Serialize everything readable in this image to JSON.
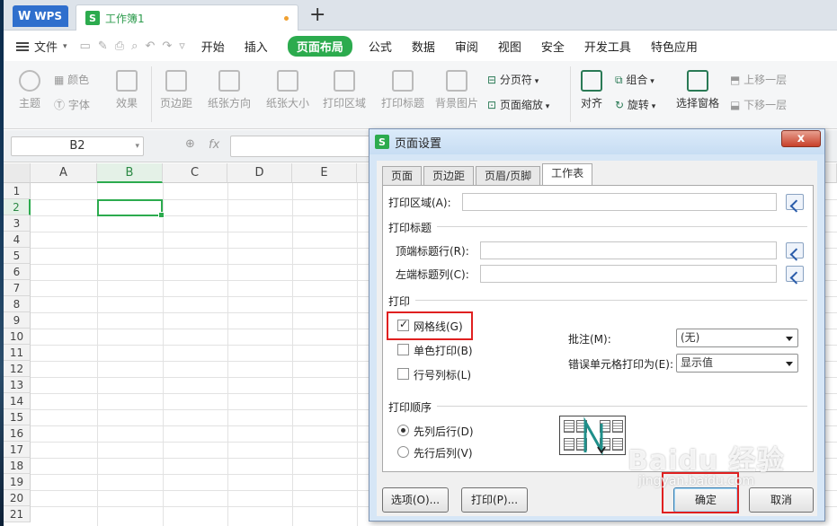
{
  "titlebar": {
    "app_tab": "WPS",
    "doc_tab": "工作簿1",
    "add_tab": "+"
  },
  "menubar": {
    "file": "文件",
    "items": [
      "开始",
      "插入",
      "页面布局",
      "公式",
      "数据",
      "审阅",
      "视图",
      "安全",
      "开发工具",
      "特色应用"
    ],
    "active_index": 2
  },
  "ribbon": {
    "theme": "主题",
    "color": "颜色",
    "font": "字体",
    "effect": "效果",
    "margin": "页边距",
    "orientation": "纸张方向",
    "size": "纸张大小",
    "print_area": "打印区域",
    "print_title": "打印标题",
    "background": "背景图片",
    "page_break": "分页符",
    "page_zoom": "页面缩放",
    "align": "对齐",
    "group": "组合",
    "rotate": "旋转",
    "select_pane": "选择窗格",
    "bring_forward": "上移一层",
    "send_backward": "下移一层"
  },
  "formula_bar": {
    "name_box": "B2",
    "fx": "fx"
  },
  "grid": {
    "columns": [
      "A",
      "B",
      "C",
      "D",
      "E"
    ],
    "rows": [
      "1",
      "2",
      "3",
      "4",
      "5",
      "6",
      "7",
      "8",
      "9",
      "10",
      "11",
      "12",
      "13",
      "14",
      "15",
      "16",
      "17",
      "18",
      "19",
      "20",
      "21"
    ],
    "selected_cell": "B2"
  },
  "dialog": {
    "title": "页面设置",
    "close": "x",
    "tabs": [
      "页面",
      "页边距",
      "页眉/页脚",
      "工作表"
    ],
    "active_tab": "工作表",
    "print_area_label": "打印区域(A):",
    "print_titles_section": "打印标题",
    "top_rows_label": "顶端标题行(R):",
    "left_cols_label": "左端标题列(C):",
    "print_section": "打印",
    "gridlines_label": "网格线(G)",
    "gridlines_checked": true,
    "mono_label": "单色打印(B)",
    "mono_checked": false,
    "rowcol_label": "行号列标(L)",
    "rowcol_checked": false,
    "comments_label": "批注(M):",
    "comments_value": "(无)",
    "errors_label": "错误单元格打印为(E):",
    "errors_value": "显示值",
    "order_section": "打印顺序",
    "order_down_label": "先列后行(D)",
    "order_down_selected": true,
    "order_over_label": "先行后列(V)",
    "order_over_selected": false,
    "options_button": "选项(O)...",
    "print_button": "打印(P)...",
    "ok_button": "确定",
    "cancel_button": "取消"
  },
  "watermark": {
    "text": "Baidu 经验",
    "sub": "jingyan.baidu.com"
  },
  "colors": {
    "accent_green": "#2cab4e",
    "wps_blue": "#2f6fcd",
    "highlight_red": "#e02020"
  }
}
